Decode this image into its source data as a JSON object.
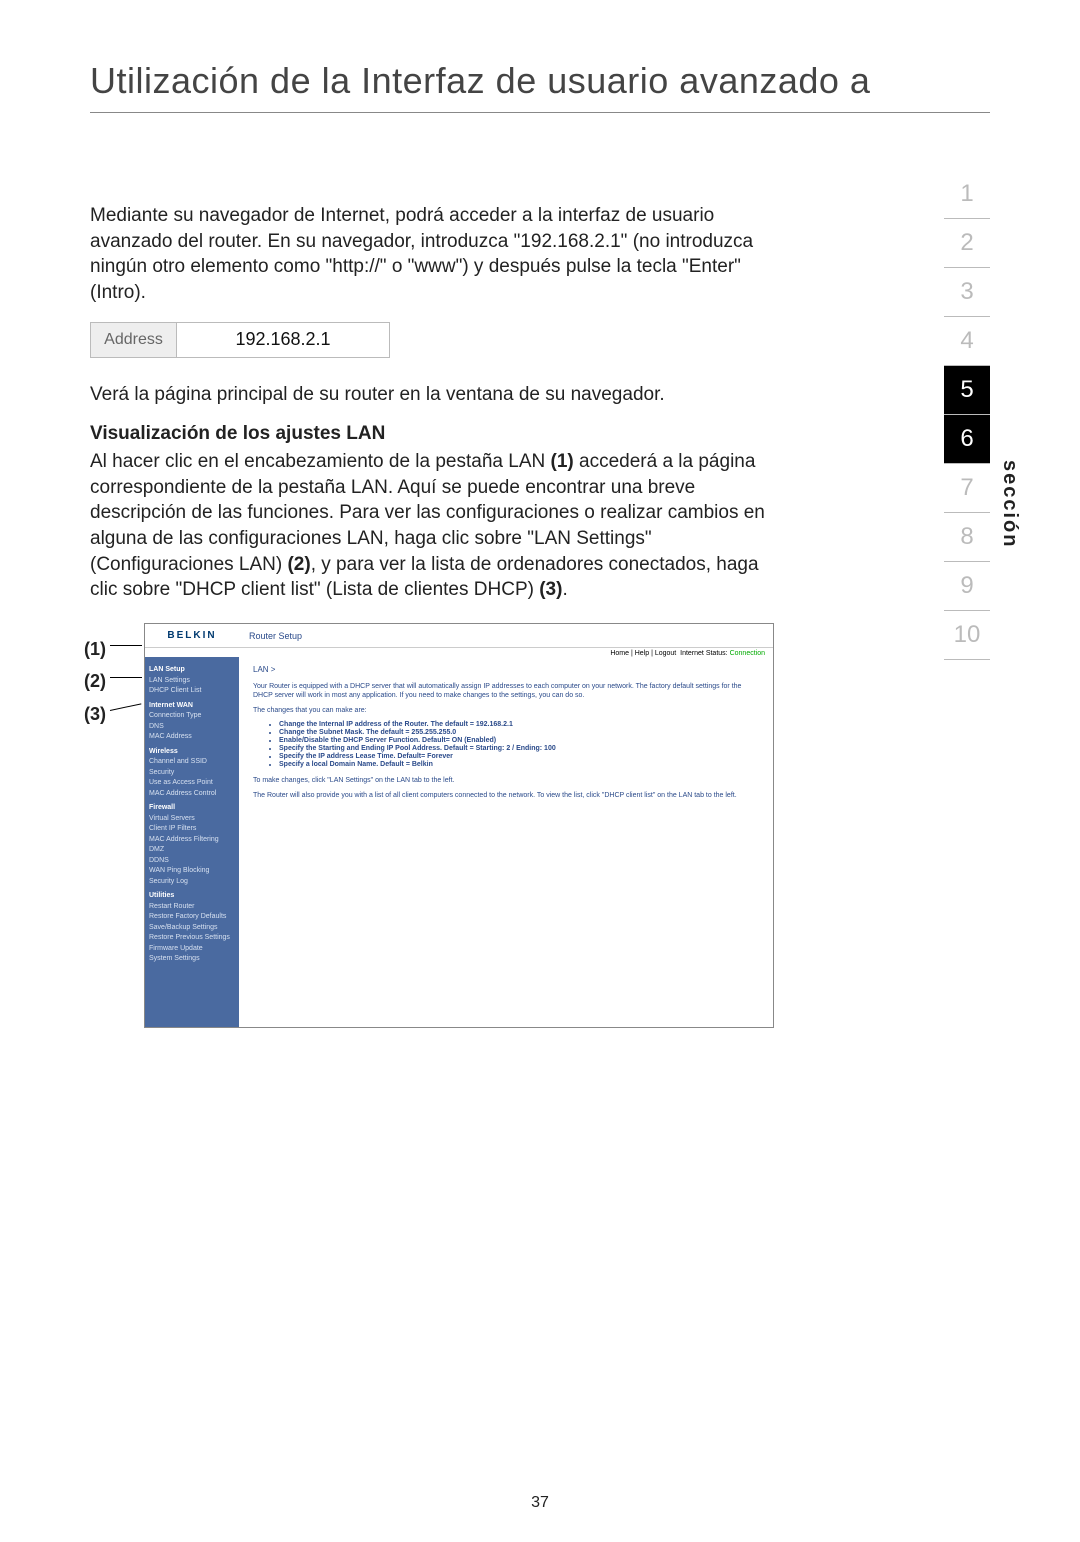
{
  "title": "Utilización de la Interfaz de usuario avanzado a",
  "intro": "Mediante su navegador de Internet, podrá acceder a la interfaz de usuario avanzado del router. En su navegador, introduzca \"192.168.2.1\" (no introduzca ningún otro elemento como \"http://\" o \"www\") y después pulse la tecla \"Enter\" (Intro).",
  "address": {
    "label": "Address",
    "value": "192.168.2.1"
  },
  "after_address": "Verá la página principal de su router en la ventana de su navegador.",
  "subhead": "Visualización de los ajustes LAN",
  "lan_para_pre": "Al hacer clic en el encabezamiento de la pestaña LAN ",
  "lan_para_a": " accederá a la página correspondiente de la pestaña LAN. Aquí se puede encontrar una breve descripción de las funciones. Para ver las configuraciones o realizar cambios en alguna de las configuraciones LAN, haga clic sobre \"LAN Settings\" (Configuraciones LAN) ",
  "lan_para_b": ", y para ver la lista de ordenadores conectados, haga clic sobre \"DHCP client list\" (Lista de clientes DHCP) ",
  "lan_para_end": ".",
  "m1": "(1)",
  "m2": "(2)",
  "m3": "(3)",
  "callouts": [
    "(1)",
    "(2)",
    "(3)"
  ],
  "nav": {
    "label": "sección",
    "items": [
      "1",
      "2",
      "3",
      "4",
      "5",
      "6",
      "7",
      "8",
      "9",
      "10"
    ],
    "active": [
      4,
      5
    ]
  },
  "router": {
    "logo": "BELKIN",
    "setup": "Router Setup",
    "status_links": "Home | Help | Logout",
    "status_label": "Internet Status:",
    "status_value": "Connection",
    "nav_groups": [
      {
        "grp": "LAN Setup",
        "items": [
          "LAN Settings",
          "DHCP Client List"
        ]
      },
      {
        "grp": "Internet WAN",
        "items": [
          "Connection Type",
          "DNS",
          "MAC Address"
        ]
      },
      {
        "grp": "Wireless",
        "items": [
          "Channel and SSID",
          "Security",
          "Use as Access Point",
          "MAC Address Control"
        ]
      },
      {
        "grp": "Firewall",
        "items": [
          "Virtual Servers",
          "Client IP Filters",
          "MAC Address Filtering",
          "DMZ",
          "DDNS",
          "WAN Ping Blocking",
          "Security Log"
        ]
      },
      {
        "grp": "Utilities",
        "items": [
          "Restart Router",
          "Restore Factory Defaults",
          "Save/Backup Settings",
          "Restore Previous Settings",
          "Firmware Update",
          "System Settings"
        ]
      }
    ],
    "crumb": "LAN >",
    "p1": "Your Router is equipped with a DHCP server that will automatically assign IP addresses to each computer on your network. The factory default settings for the DHCP server will work in most any application. If you need to make changes to the settings, you can do so.",
    "p2": "The changes that you can make are:",
    "bullets": [
      "Change the Internal IP address of the Router. The default = 192.168.2.1",
      "Change the Subnet Mask. The default = 255.255.255.0",
      "Enable/Disable the DHCP Server Function. Default= ON (Enabled)",
      "Specify the Starting and Ending IP Pool Address. Default = Starting: 2 / Ending: 100",
      "Specify the IP address Lease Time. Default= Forever",
      "Specify a local Domain Name. Default = Belkin"
    ],
    "p3": "To make changes, click \"LAN Settings\" on the LAN tab to the left.",
    "p4": "The Router will also provide you with a list of all client computers connected to the network. To view the list, click \"DHCP client list\" on the LAN tab to the left."
  },
  "page_num": "37"
}
